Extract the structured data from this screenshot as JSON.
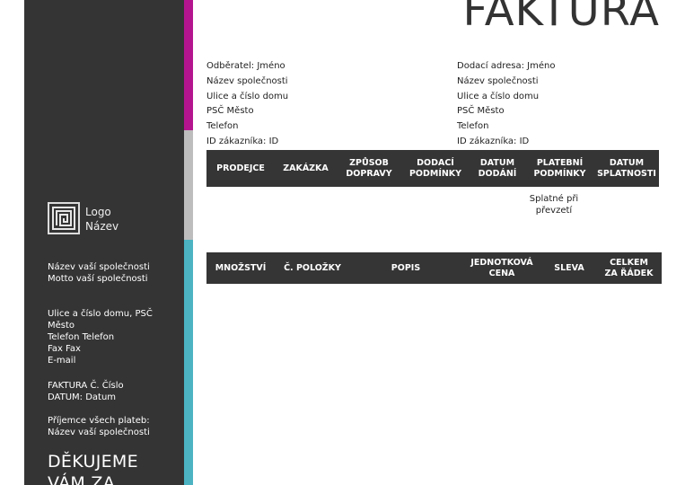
{
  "document": {
    "title": "FAKTURA"
  },
  "colors": {
    "sidebar_bg": "#343434",
    "accent_magenta": "#b4158f",
    "accent_gray": "#bdbdbd",
    "accent_teal": "#4bb3c2",
    "table_header_bg": "#353535"
  },
  "sidebar": {
    "logo": {
      "icon": "maze-logo-icon",
      "line1": "Logo",
      "line2": "Název"
    },
    "company": {
      "name": "Název vaší společnosti",
      "motto": "Motto vaší společnosti"
    },
    "contact": {
      "street": "Ulice a číslo domu, PSČ",
      "city": "Město",
      "phone": "Telefon Telefon",
      "fax": "Fax Fax",
      "email": "E-mail"
    },
    "invoice": {
      "number": "FAKTURA Č. Číslo",
      "date": "DATUM: Datum"
    },
    "payee": {
      "label": "Příjemce všech plateb:",
      "name": "Název vaší společnosti"
    },
    "thanks": {
      "line1": "DĚKUJEME",
      "line2": "VÁM ZA"
    }
  },
  "billing": {
    "customer": "Odběratel: Jméno",
    "company": "Název společnosti",
    "street": "Ulice a číslo domu",
    "city": "PSČ Město",
    "phone": "Telefon",
    "customer_id": "ID zákazníka: ID"
  },
  "shipping": {
    "customer": "Dodací adresa: Jméno",
    "company": "Název společnosti",
    "street": "Ulice a číslo domu",
    "city": "PSČ Město",
    "phone": "Telefon",
    "customer_id": "ID zákazníka: ID"
  },
  "order_table": {
    "headers": [
      {
        "line1": "PRODEJCE",
        "line2": ""
      },
      {
        "line1": "ZAKÁZKA",
        "line2": ""
      },
      {
        "line1": "ZPŮSOB",
        "line2": "DOPRAVY"
      },
      {
        "line1": "DODACÍ",
        "line2": "PODMÍNKY"
      },
      {
        "line1": "DATUM",
        "line2": "DODÁNÍ"
      },
      {
        "line1": "PLATEBNÍ",
        "line2": "PODMÍNKY"
      },
      {
        "line1": "DATUM",
        "line2": "SPLATNOSTI"
      }
    ],
    "payment_terms_value": {
      "line1": "Splatné při",
      "line2": "převzetí"
    }
  },
  "items_table": {
    "headers": [
      {
        "line1": "MNOŽSTVÍ",
        "line2": ""
      },
      {
        "line1": "Č. POLOŽKY",
        "line2": ""
      },
      {
        "line1": "POPIS",
        "line2": ""
      },
      {
        "line1": "JEDNOTKOVÁ",
        "line2": "CENA"
      },
      {
        "line1": "SLEVA",
        "line2": ""
      },
      {
        "line1": "CELKEM",
        "line2": "ZA ŘÁDEK"
      }
    ]
  }
}
